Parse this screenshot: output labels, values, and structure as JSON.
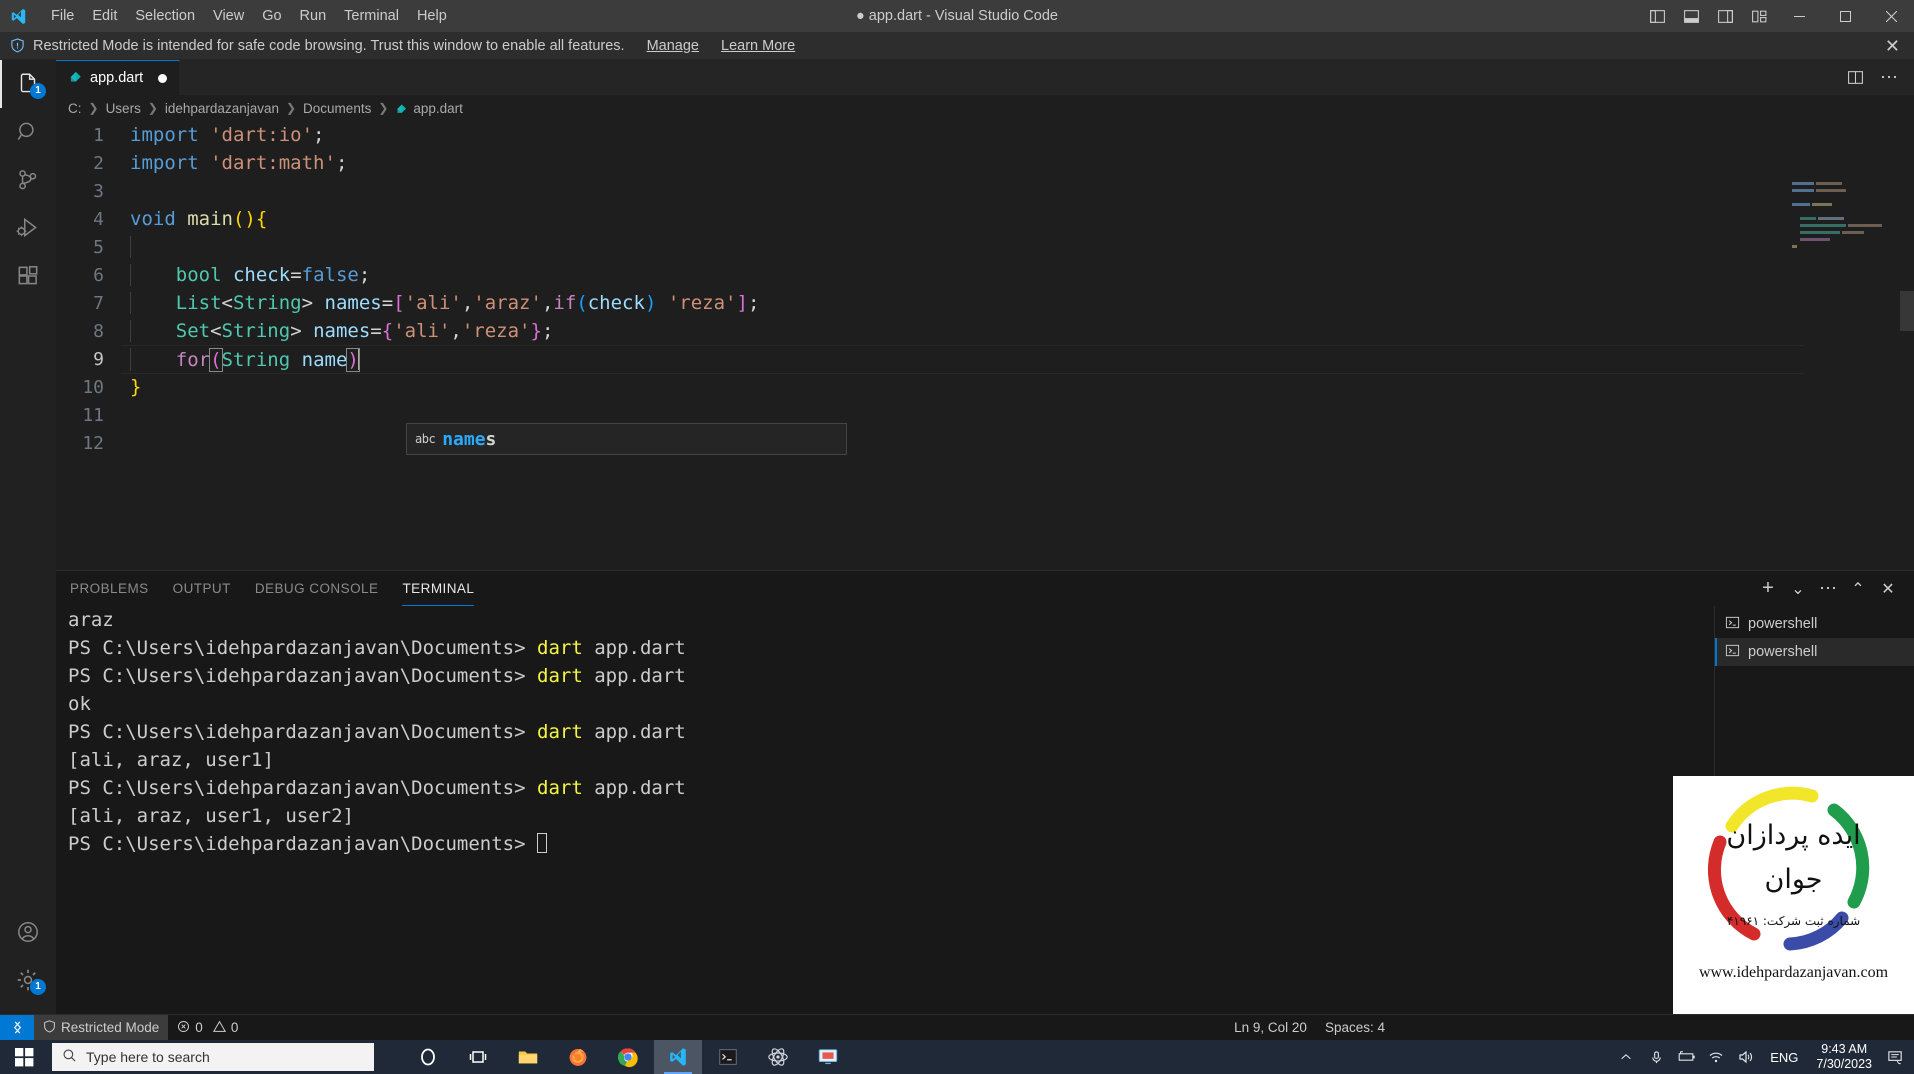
{
  "titlebar": {
    "logo_icon": "vscode-logo-icon",
    "menus": [
      "File",
      "Edit",
      "Selection",
      "View",
      "Go",
      "Run",
      "Terminal",
      "Help"
    ],
    "window_title": "● app.dart - Visual Studio Code",
    "layout_buttons": [
      {
        "icon": "toggle-primary-sidebar-icon",
        "label": "Toggle Primary Side Bar"
      },
      {
        "icon": "toggle-panel-icon",
        "label": "Toggle Panel"
      },
      {
        "icon": "toggle-secondary-sidebar-icon",
        "label": "Toggle Secondary Side Bar"
      },
      {
        "icon": "customize-layout-icon",
        "label": "Customize Layout"
      }
    ],
    "window_controls": [
      {
        "icon": "minimize-icon",
        "glyph": "—"
      },
      {
        "icon": "maximize-icon",
        "glyph": "▢"
      },
      {
        "icon": "close-icon",
        "glyph": "✕"
      }
    ]
  },
  "banner": {
    "icon": "shield-icon",
    "message": "Restricted Mode is intended for safe code browsing. Trust this window to enable all features.",
    "manage_link": "Manage",
    "learn_more_link": "Learn More",
    "close_glyph": "✕"
  },
  "activitybar": {
    "items": [
      {
        "name": "explorer",
        "icon": "files-icon",
        "badge": "1",
        "active": true
      },
      {
        "name": "search",
        "icon": "search-icon",
        "badge": "",
        "active": false
      },
      {
        "name": "source-control",
        "icon": "source-control-icon",
        "badge": "",
        "active": false
      },
      {
        "name": "run-and-debug",
        "icon": "run-debug-icon",
        "badge": "",
        "active": false
      },
      {
        "name": "extensions",
        "icon": "extensions-icon",
        "badge": "",
        "active": false
      }
    ],
    "bottom_items": [
      {
        "name": "accounts",
        "icon": "account-icon",
        "badge": ""
      },
      {
        "name": "settings",
        "icon": "gear-icon",
        "badge": "1"
      }
    ]
  },
  "editor": {
    "tab": {
      "label": "app.dart",
      "file_icon": "dart-file-icon",
      "dirty": true
    },
    "tab_actions": [
      {
        "icon": "split-editor-icon"
      },
      {
        "icon": "more-actions-icon",
        "glyph": "⋯"
      }
    ],
    "breadcrumb": [
      "C:",
      "Users",
      "idehpardazanjavan",
      "Documents",
      "app.dart"
    ],
    "breadcrumb_file_icon": "dart-file-icon",
    "lines": [
      {
        "n": "1",
        "text": "import 'dart:io';"
      },
      {
        "n": "2",
        "text": "import 'dart:math';"
      },
      {
        "n": "3",
        "text": ""
      },
      {
        "n": "4",
        "text": "void main(){"
      },
      {
        "n": "5",
        "text": ""
      },
      {
        "n": "6",
        "text": "    bool check=false;"
      },
      {
        "n": "7",
        "text": "    List<String> names=['ali','araz',if(check) 'reza'];"
      },
      {
        "n": "8",
        "text": "    Set<String> names={'ali','reza'};"
      },
      {
        "n": "9",
        "text": "    for(String name)"
      },
      {
        "n": "10",
        "text": "}"
      },
      {
        "n": "11",
        "text": ""
      },
      {
        "n": "12",
        "text": ""
      }
    ],
    "active_line": "9",
    "suggestion": {
      "kind_icon": "abc-icon",
      "kind_label": "abc",
      "matched_prefix": "name",
      "remainder": "s",
      "full_label": "names"
    }
  },
  "panel": {
    "tabs": [
      {
        "label": "PROBLEMS",
        "active": false
      },
      {
        "label": "OUTPUT",
        "active": false
      },
      {
        "label": "DEBUG CONSOLE",
        "active": false
      },
      {
        "label": "TERMINAL",
        "active": true
      }
    ],
    "actions": [
      {
        "icon": "add-terminal-icon",
        "glyph": "+"
      },
      {
        "icon": "chevron-down-icon",
        "glyph": "⌄"
      },
      {
        "icon": "more-actions-icon",
        "glyph": "⋯"
      },
      {
        "icon": "maximize-panel-icon",
        "glyph": "⌃"
      },
      {
        "icon": "close-panel-icon",
        "glyph": "✕"
      }
    ],
    "terminal_lines": [
      {
        "type": "output",
        "text": "araz"
      },
      {
        "type": "prompt",
        "prompt": "PS C:\\Users\\idehpardazanjavan\\Documents> ",
        "cmd": "dart",
        "args": " app.dart"
      },
      {
        "type": "prompt",
        "prompt": "PS C:\\Users\\idehpardazanjavan\\Documents> ",
        "cmd": "dart",
        "args": " app.dart"
      },
      {
        "type": "output",
        "text": "ok"
      },
      {
        "type": "prompt",
        "prompt": "PS C:\\Users\\idehpardazanjavan\\Documents> ",
        "cmd": "dart",
        "args": " app.dart"
      },
      {
        "type": "output",
        "text": "[ali, araz, user1]"
      },
      {
        "type": "prompt",
        "prompt": "PS C:\\Users\\idehpardazanjavan\\Documents> ",
        "cmd": "dart",
        "args": " app.dart"
      },
      {
        "type": "output",
        "text": "[ali, araz, user1, user2]"
      },
      {
        "type": "cursor",
        "prompt": "PS C:\\Users\\idehpardazanjavan\\Documents> "
      }
    ],
    "terminal_tabs": [
      {
        "label": "powershell",
        "icon": "terminal-icon",
        "active": false
      },
      {
        "label": "powershell",
        "icon": "terminal-icon",
        "active": true
      }
    ]
  },
  "statusbar": {
    "remote_icon": "remote-window-icon",
    "restricted_mode": {
      "icon": "shield-icon",
      "label": "Restricted Mode"
    },
    "errors": {
      "icon": "error-icon",
      "count": "0"
    },
    "warnings": {
      "icon": "warning-icon",
      "count": "0"
    },
    "cursor_position": "Ln 9, Col 20",
    "indentation": "Spaces: 4"
  },
  "watermark": {
    "title_line1": "ایده پردازان",
    "title_line2": "جوان",
    "registration": "شماره ثبت شرکت: ۴۱۹۶۱",
    "url": "www.idehpardazanjavan.com",
    "ring_colors": {
      "yellow": "#f2e62a",
      "green": "#1f9d4d",
      "blue": "#3b4ba8",
      "red": "#d42b2b"
    }
  },
  "taskbar": {
    "start_icon": "windows-start-icon",
    "search_icon": "search-icon",
    "search_placeholder": "Type here to search",
    "apps": [
      {
        "name": "cortana",
        "icon": "cortana-icon",
        "active": false
      },
      {
        "name": "task-view",
        "icon": "task-view-icon",
        "active": false
      },
      {
        "name": "file-explorer",
        "icon": "file-explorer-icon",
        "active": false
      },
      {
        "name": "firefox",
        "icon": "firefox-icon",
        "active": false
      },
      {
        "name": "chrome",
        "icon": "chrome-icon",
        "active": false
      },
      {
        "name": "visual-studio-code",
        "icon": "vscode-icon",
        "active": true
      },
      {
        "name": "terminal",
        "icon": "terminal-app-icon",
        "active": false
      },
      {
        "name": "atom",
        "icon": "atom-icon",
        "active": false
      },
      {
        "name": "media-app",
        "icon": "media-app-icon",
        "active": false
      }
    ],
    "tray": [
      {
        "name": "show-hidden-icons",
        "icon": "chevron-up-icon"
      },
      {
        "name": "microphone",
        "icon": "microphone-icon"
      },
      {
        "name": "battery",
        "icon": "battery-charging-icon"
      },
      {
        "name": "network",
        "icon": "wifi-icon"
      },
      {
        "name": "volume",
        "icon": "speaker-icon"
      }
    ],
    "language": "ENG",
    "time": "9:43 AM",
    "date": "7/30/2023",
    "notifications_icon": "notifications-icon"
  },
  "colors": {
    "accent": "#0078d4",
    "editor_bg": "#1e1e1e",
    "titlebar_bg": "#3c3c3c",
    "panel_bg": "#181818",
    "taskbar_bg": "#1f2937"
  }
}
